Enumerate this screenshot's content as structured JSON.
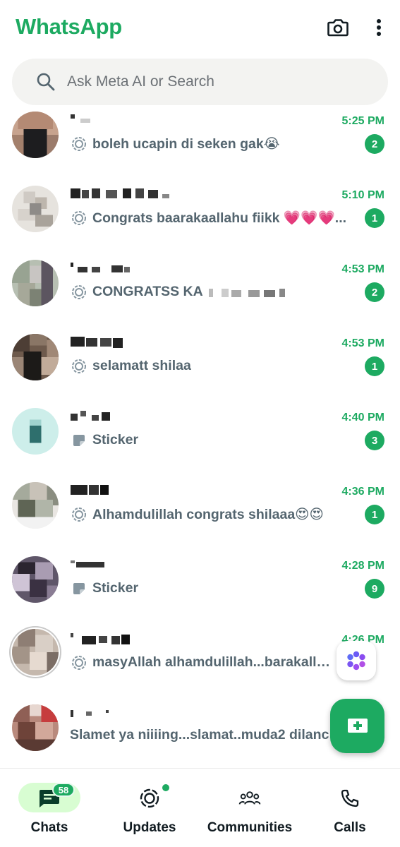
{
  "colors": {
    "accent": "#1daa61",
    "text": "#111b21",
    "muted": "#54656f",
    "search_bg": "#f3f3f1"
  },
  "header": {
    "title": "WhatsApp",
    "icons": [
      "camera-icon",
      "more-vert-icon"
    ]
  },
  "search": {
    "placeholder": "Ask Meta AI or Search",
    "icon": "search-icon"
  },
  "chats": [
    {
      "time": "5:25 PM",
      "preview": "boleh ucapin di seken gak😭",
      "preview_icon": "status-ring-icon",
      "unread": "2"
    },
    {
      "time": "5:10 PM",
      "preview": "Congrats baarakaallahu fiikk 💗💗💗...",
      "preview_icon": "status-ring-icon",
      "unread": "1"
    },
    {
      "time": "4:53 PM",
      "preview": "CONGRATSS KA",
      "preview_icon": "status-ring-icon",
      "unread": "2"
    },
    {
      "time": "4:53 PM",
      "preview": "selamatt shilaa",
      "preview_icon": "status-ring-icon",
      "unread": "1"
    },
    {
      "time": "4:40 PM",
      "preview": "Sticker",
      "preview_icon": "sticker-icon",
      "unread": "3"
    },
    {
      "time": "4:36 PM",
      "preview": "Alhamdulillah congrats shilaaa😍😍",
      "preview_icon": "status-ring-icon",
      "unread": "1"
    },
    {
      "time": "4:28 PM",
      "preview": "Sticker",
      "preview_icon": "sticker-icon",
      "unread": "9"
    },
    {
      "time": "4:26 PM",
      "preview": "masyAllah alhamdulillah...barakallahu",
      "preview_icon": "status-ring-icon",
      "unread": ""
    },
    {
      "time": "",
      "preview": "Slamet ya niiiing...slamat..muda2 dilanc",
      "preview_icon": "",
      "unread": ""
    }
  ],
  "fab": {
    "meta_ai_icon": "meta-ai-icon",
    "new_chat_icon": "new-chat-icon"
  },
  "nav": {
    "chats": {
      "label": "Chats",
      "count": "58",
      "icon": "chats-icon"
    },
    "updates": {
      "label": "Updates",
      "icon": "updates-icon"
    },
    "communities": {
      "label": "Communities",
      "icon": "communities-icon"
    },
    "calls": {
      "label": "Calls",
      "icon": "calls-icon"
    }
  }
}
